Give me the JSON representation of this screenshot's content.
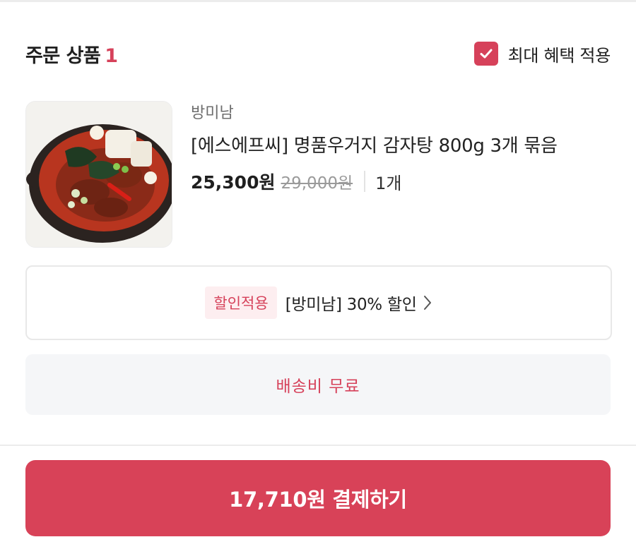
{
  "header": {
    "title": "주문 상품",
    "count": "1",
    "benefit_label": "최대 혜택 적용",
    "benefit_checked": true
  },
  "product": {
    "seller": "방미남",
    "name": "[에스에프씨] 명품우거지 감자탕 800g 3개 묶음",
    "price": "25,300원",
    "original_price": "29,000원",
    "quantity": "1개",
    "image_icon": "gamjatang-food-photo"
  },
  "coupon": {
    "badge": "할인적용",
    "text": "[방미남] 30% 할인",
    "icon": "chevron-right-icon"
  },
  "shipping": {
    "text": "배송비 무료"
  },
  "payment": {
    "label": "17,710원 결제하기"
  },
  "colors": {
    "accent": "#d84258",
    "badge_bg": "#fdeef0",
    "shipping_bg": "#f5f6f8"
  }
}
